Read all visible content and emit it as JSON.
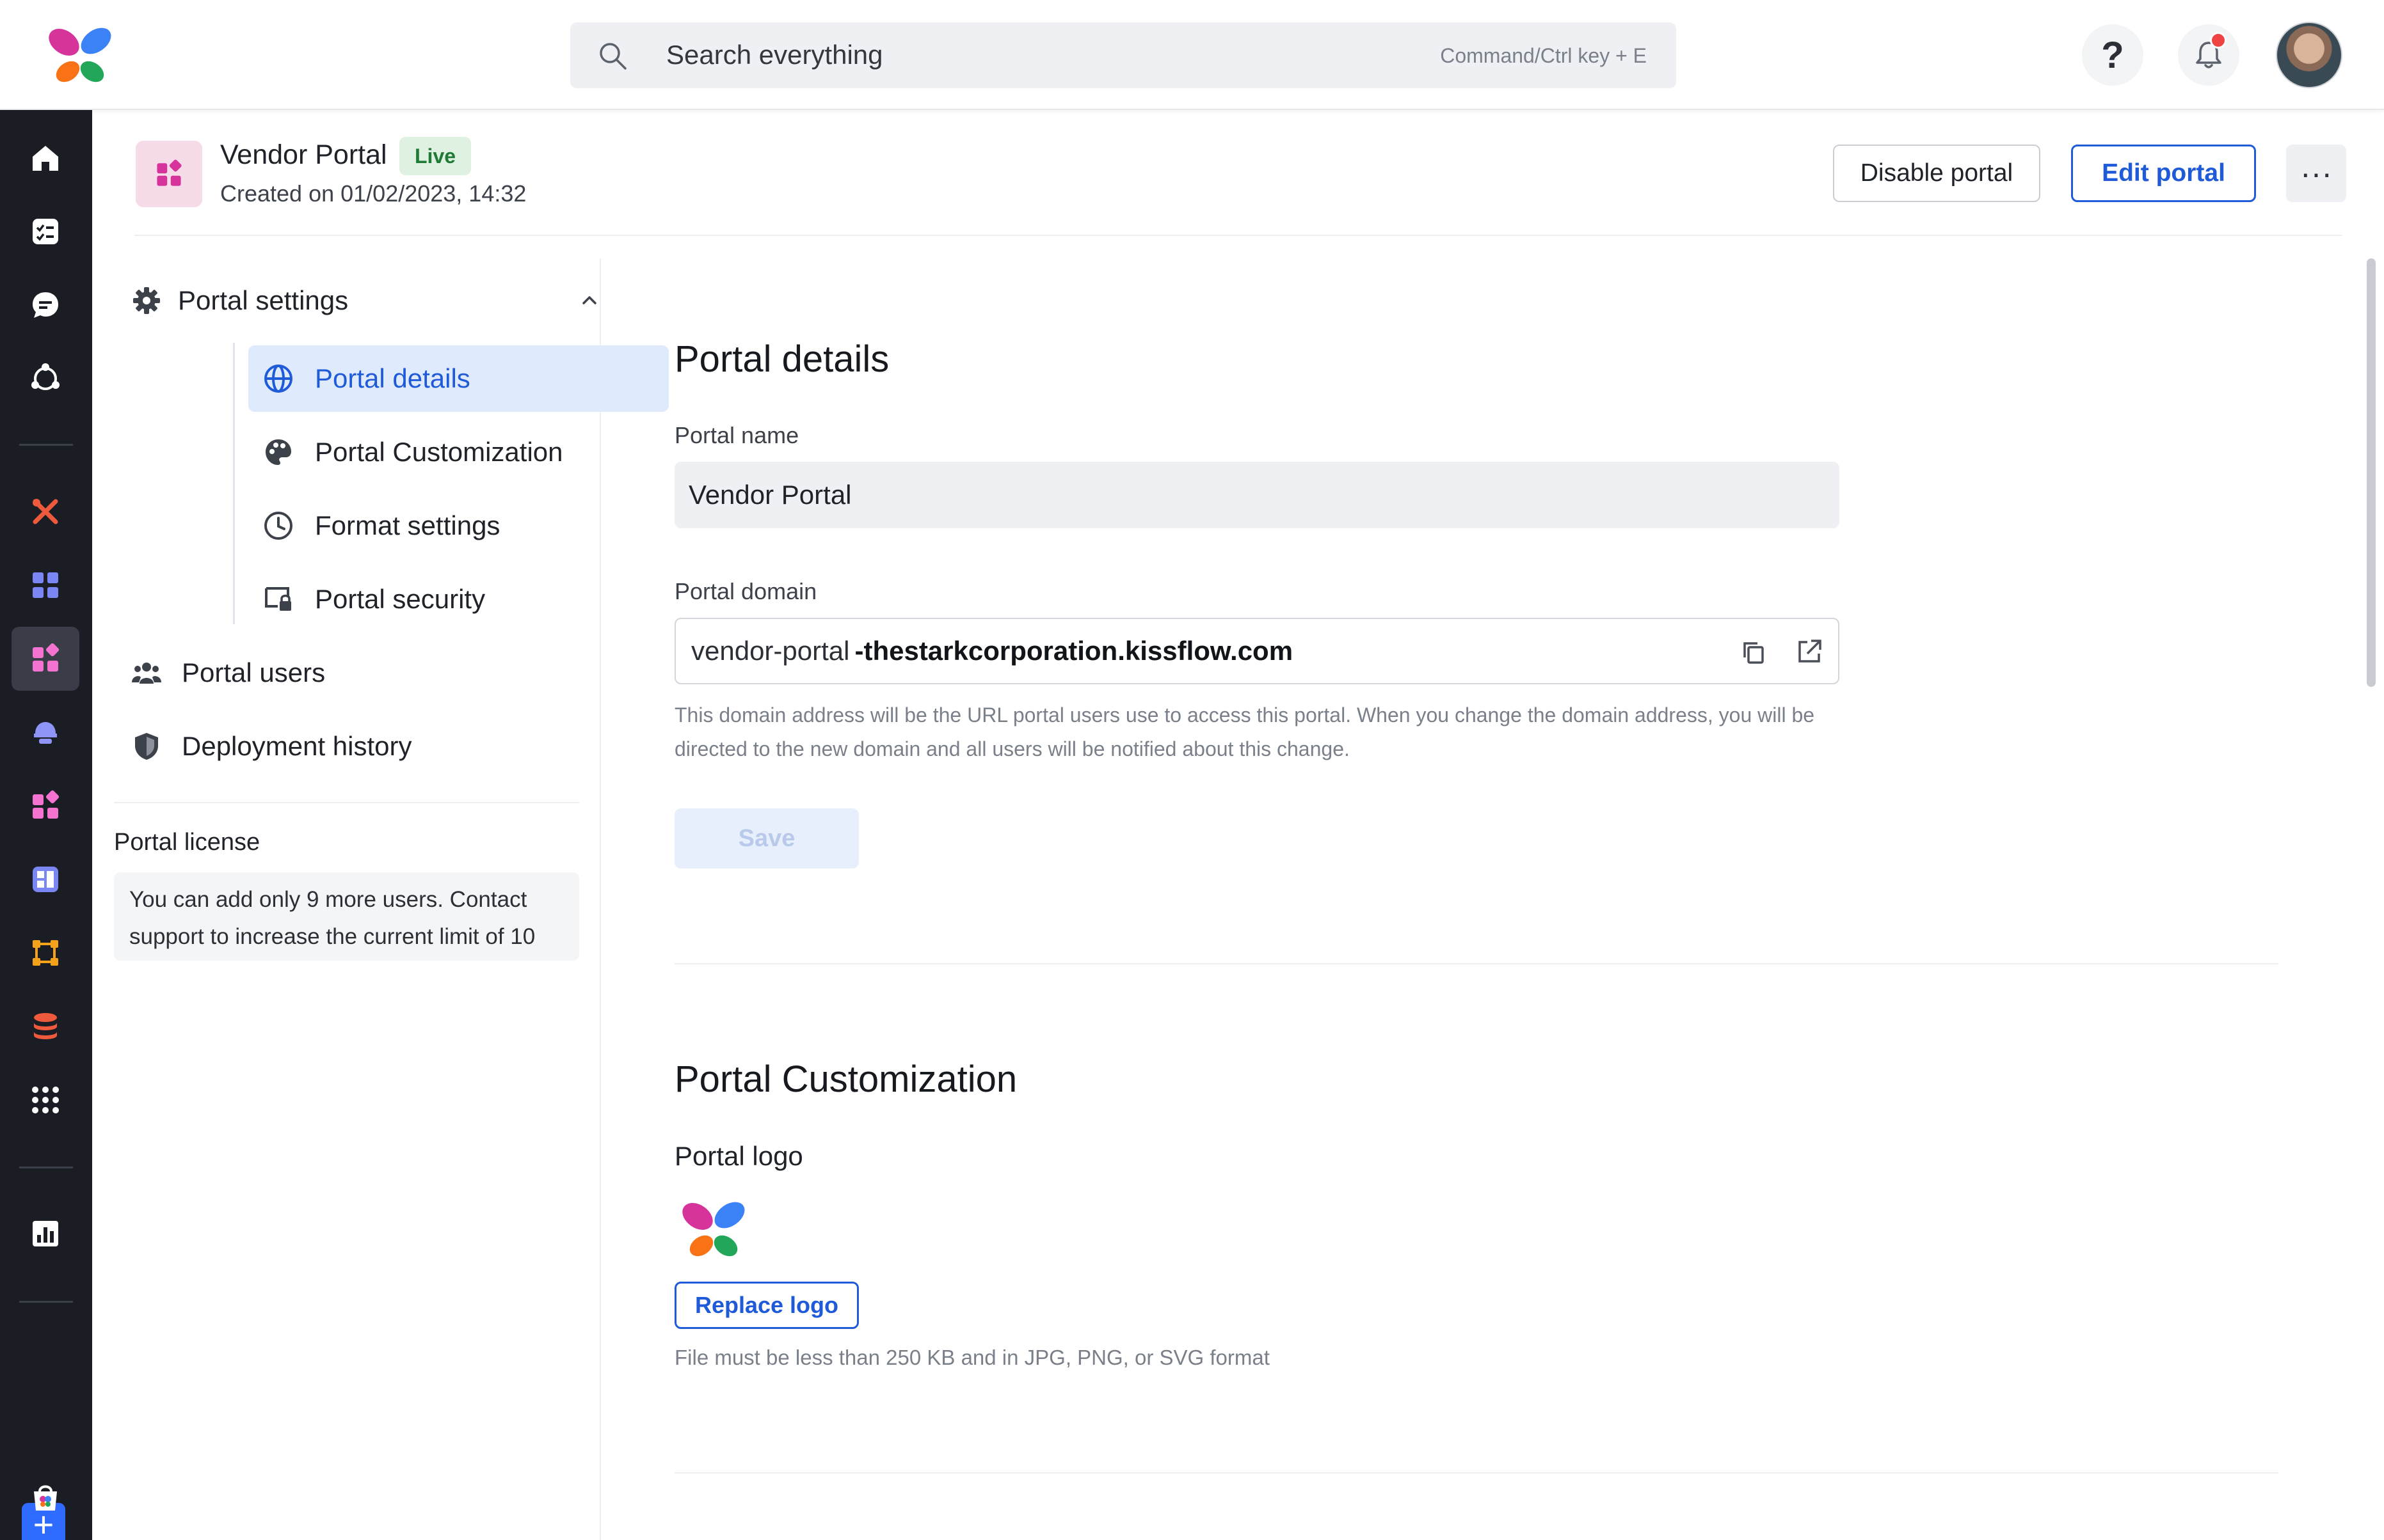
{
  "topbar": {
    "search": {
      "placeholder": "Search everything",
      "shortcut_hint": "Command/Ctrl key + E"
    },
    "help_label": "?"
  },
  "header": {
    "portal_name": "Vendor Portal",
    "status_badge": "Live",
    "created_on": "Created on 01/02/2023, 14:32",
    "disable_label": "Disable portal",
    "edit_label": "Edit portal",
    "more_label": "···"
  },
  "settings_nav": {
    "group_label": "Portal settings",
    "sub_items": [
      {
        "label": "Portal details",
        "icon": "globe-icon",
        "active": true
      },
      {
        "label": "Portal Customization",
        "icon": "palette-icon",
        "active": false
      },
      {
        "label": "Format settings",
        "icon": "clock-icon",
        "active": false
      },
      {
        "label": "Portal security",
        "icon": "lock-screen-icon",
        "active": false
      }
    ],
    "top_items": [
      {
        "label": "Portal users",
        "icon": "users-icon"
      },
      {
        "label": "Deployment history",
        "icon": "shield-icon"
      }
    ],
    "license": {
      "title": "Portal license",
      "message": "You can add only 9 more users. Contact support to increase the current limit of 10"
    }
  },
  "portal_details": {
    "title": "Portal details",
    "name_label": "Portal name",
    "name_value": "Vendor Portal",
    "domain_label": "Portal domain",
    "domain_prefix": "vendor-portal",
    "domain_suffix": "-thestarkcorporation.kissflow.com",
    "domain_help": "This domain address will be the URL portal users use to access this portal. When you change the domain address, you will be directed to the new domain and all users will be notified about this change.",
    "save_label": "Save"
  },
  "portal_customization": {
    "title": "Portal Customization",
    "logo_label": "Portal logo",
    "replace_label": "Replace logo",
    "logo_help": "File must be less than 250 KB and in JPG, PNG, or SVG format"
  },
  "colors": {
    "accent": "#1f5bd8",
    "rail_bg": "#1b1d24",
    "live_badge_bg": "#dff2e1",
    "active_nav_bg": "#dfeafc"
  }
}
